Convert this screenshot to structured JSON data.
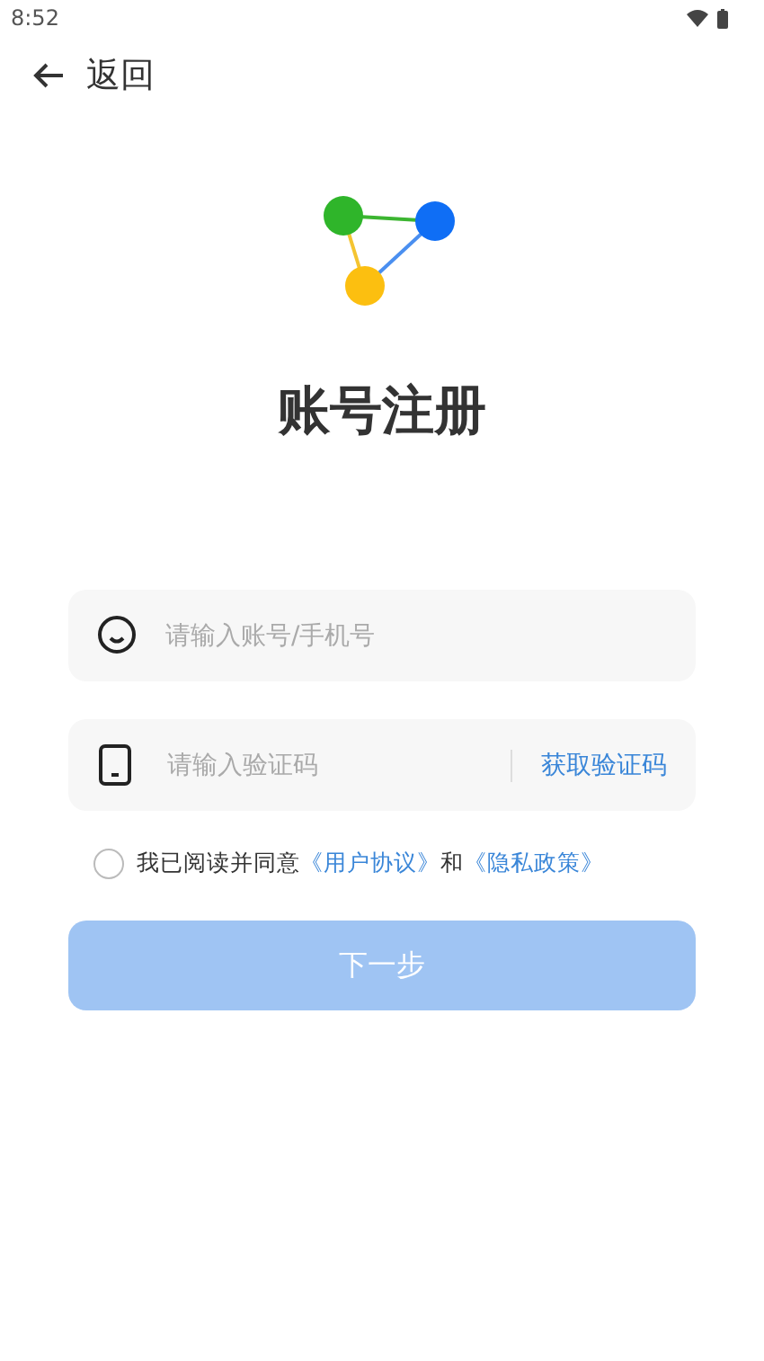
{
  "status_bar": {
    "time": "8:52"
  },
  "header": {
    "back_label": "返回"
  },
  "title": "账号注册",
  "account_field": {
    "placeholder": "请输入账号/手机号"
  },
  "code_field": {
    "placeholder": "请输入验证码",
    "action": "获取验证码"
  },
  "agreement": {
    "checked": false,
    "parts": [
      {
        "kind": "text",
        "text": "我已阅读并同意"
      },
      {
        "kind": "link",
        "text": "《用户协议》"
      },
      {
        "kind": "text",
        "text": "和"
      },
      {
        "kind": "link",
        "text": "《隐私政策》"
      }
    ]
  },
  "next_button": {
    "label": "下一步",
    "disabled": true
  }
}
